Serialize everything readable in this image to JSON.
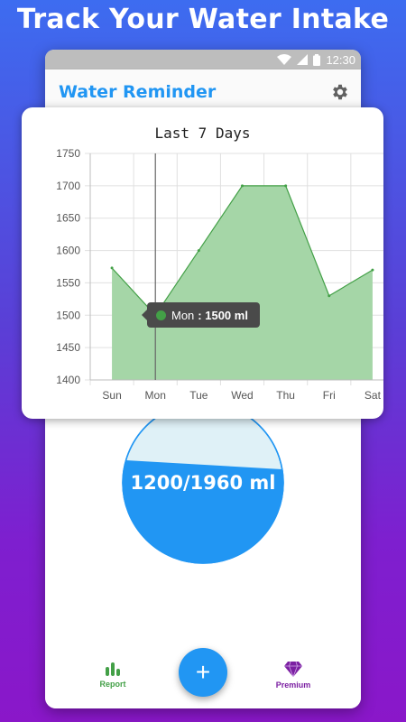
{
  "headline": "Track Your Water Intake",
  "status_bar": {
    "time": "12:30"
  },
  "app": {
    "title": "Water Reminder"
  },
  "intake": {
    "label": "1200/1960 ml",
    "consumed_ml": 1200,
    "goal_ml": 1960
  },
  "bottom_nav": {
    "report_label": "Report",
    "add_label": "+",
    "premium_label": "Premium"
  },
  "colors": {
    "primary": "#2196f3",
    "chart_fill": "#a5d6a7",
    "chart_line": "#43a047",
    "premium": "#7b1fa2",
    "report": "#43a047"
  },
  "chart_data": {
    "type": "area",
    "title": "Last 7 Days",
    "categories": [
      "Sun",
      "Mon",
      "Tue",
      "Wed",
      "Thu",
      "Fri",
      "Sat"
    ],
    "values": [
      1573,
      1500,
      1600,
      1700,
      1700,
      1530,
      1570
    ],
    "ylim": [
      1400,
      1750
    ],
    "yticks": [
      1400,
      1450,
      1500,
      1550,
      1600,
      1650,
      1700,
      1750
    ],
    "grid": true,
    "tooltip": {
      "category": "Mon",
      "label": "Mon",
      "value_text": ": 1500 ml"
    }
  }
}
